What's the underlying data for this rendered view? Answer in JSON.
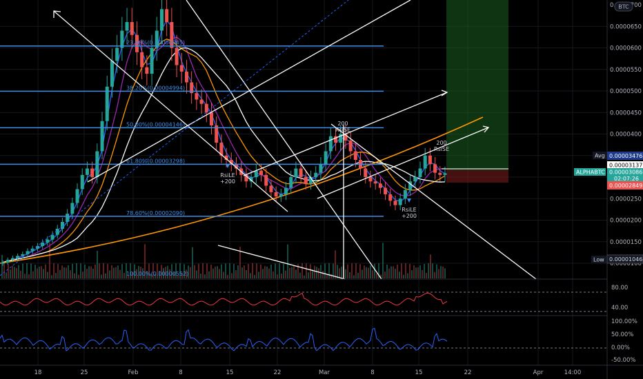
{
  "chart_data": {
    "type": "candlestick",
    "symbol": "ALPHABTC",
    "currency_badge": "BTC",
    "price_axis_ticks": [
      "0.0000650",
      "0.0000600",
      "0.0000550",
      "0.0000500",
      "0.0000450",
      "0.0000400",
      "0.0000350",
      "0.0000300",
      "0.0000250",
      "0.0000200",
      "0.0000150",
      "0.0000100"
    ],
    "price_top_label": "0.0000700",
    "ylim": [
      8e-06,
      7.1e-05
    ],
    "time_axis_ticks": [
      "18",
      "25",
      "Feb",
      "8",
      "15",
      "22",
      "Mar",
      "8",
      "15",
      "22",
      "Apr",
      "14:00"
    ],
    "fib_levels": [
      {
        "label": "23.60%(0.00006045)",
        "value": 6.045e-05
      },
      {
        "label": "38.20%(0.00004994)",
        "value": 4.994e-05
      },
      {
        "label": "50.00%(0.00004146)",
        "value": 4.146e-05
      },
      {
        "label": "61.80%(0.00003298)",
        "value": 3.298e-05
      },
      {
        "label": "78.60%(0.00002090)",
        "value": 2.09e-05
      },
      {
        "label": "100.00%(0.00000552)",
        "value": 5.52e-06
      }
    ],
    "price_tags": {
      "avg": {
        "label": "Avg",
        "value": "0.00003476",
        "color": "#2962ff"
      },
      "high_line": {
        "value": "0.00003137"
      },
      "last": {
        "symbol": "ALPHABTC",
        "value": "0.00003086",
        "countdown": "02:07:26",
        "color": "#26a69a"
      },
      "stop": {
        "value": "0.00002849",
        "color": "#ef5350"
      },
      "low": {
        "label": "Low",
        "value": "0.00001046"
      }
    },
    "annotations": [
      {
        "text": "RsiLE",
        "sub": "+200"
      },
      {
        "text": "200",
        "sub": "RsiSE"
      },
      {
        "text": "RsiLE",
        "sub": "+200"
      },
      {
        "text": "200",
        "sub": "RsiSE"
      }
    ],
    "candles_close": [
      1.02e-05,
      1.08e-05,
      1.12e-05,
      1.17e-05,
      1.21e-05,
      1.28e-05,
      1.34e-05,
      1.4e-05,
      1.48e-05,
      1.55e-05,
      1.66e-05,
      1.8e-05,
      1.96e-05,
      2.15e-05,
      2.4e-05,
      2.72e-05,
      3.05e-05,
      3.2e-05,
      3e-05,
      3.6e-05,
      4.3e-05,
      5.1e-05,
      5.7e-05,
      6e-05,
      6.4e-05,
      6.6e-05,
      6.3e-05,
      5.9e-05,
      5.55e-05,
      5.4e-05,
      6e-05,
      6.4e-05,
      6.9e-05,
      6.6e-05,
      6e-05,
      5.6e-05,
      5.45e-05,
      5.2e-05,
      4.95e-05,
      4.8e-05,
      4.7e-05,
      4.5e-05,
      4.2e-05,
      3.8e-05,
      3.5e-05,
      3.4e-05,
      3.3e-05,
      3.2e-05,
      3.05e-05,
      2.9e-05,
      3e-05,
      3.15e-05,
      3.05e-05,
      2.8e-05,
      2.65e-05,
      2.55e-05,
      2.6e-05,
      2.75e-05,
      3e-05,
      3.2e-05,
      3e-05,
      2.85e-05,
      3e-05,
      3.1e-05,
      3.3e-05,
      3.6e-05,
      3.95e-05,
      3.8e-05,
      4e-05,
      3.85e-05,
      3.6e-05,
      3.4e-05,
      3.2e-05,
      3e-05,
      2.9e-05,
      2.85e-05,
      2.75e-05,
      2.6e-05,
      2.45e-05,
      2.35e-05,
      2.5e-05,
      2.7e-05,
      2.9e-05,
      3e-05,
      3.2e-05,
      3.5e-05,
      3.3e-05,
      3.1e-05,
      3.05e-05,
      3.09e-05
    ],
    "indicators": {
      "rsi": {
        "ticks": [
          "80.00",
          "40.00"
        ],
        "color": "#f23645"
      },
      "percent": {
        "ticks": [
          "100.00%",
          "50.00%",
          "0.00%",
          "-50.00%"
        ],
        "color": "#2962ff"
      }
    }
  }
}
